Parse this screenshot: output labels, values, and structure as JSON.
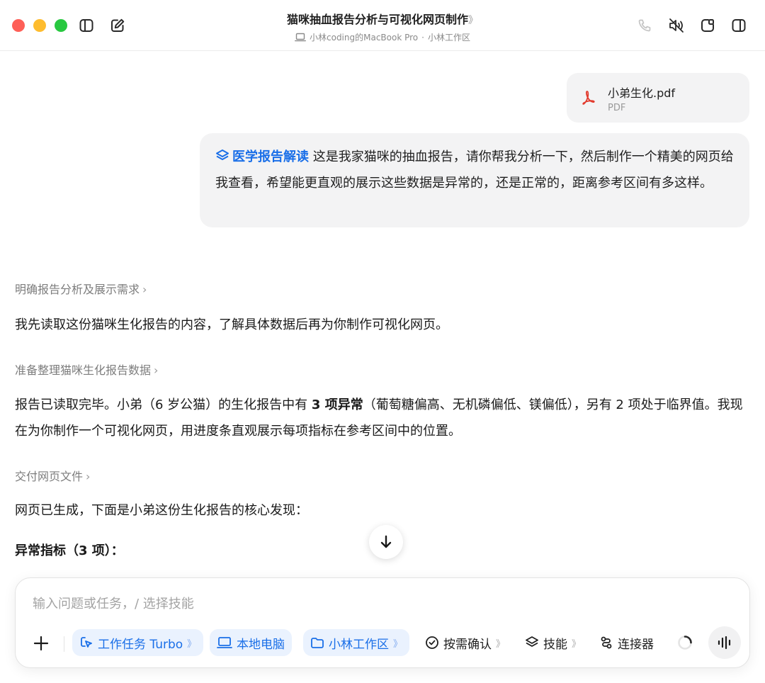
{
  "window": {
    "title": "猫咪抽血报告分析与可视化网页制作",
    "title_chevron": "》",
    "subtitle_device": "小林coding的MacBook Pro",
    "subtitle_sep": "·",
    "subtitle_workspace": "小林工作区"
  },
  "attachment": {
    "file_name": "小弟生化.pdf",
    "file_type": "PDF"
  },
  "user_message": {
    "skill_label": "医学报告解读",
    "text": "这是我家猫咪的抽血报告，请你帮我分析一下，然后制作一个精美的网页给我查看，希望能更直观的展示这些数据是异常的，还是正常的，距离参考区间有多这样。"
  },
  "assistant": {
    "step1": "明确报告分析及展示需求",
    "para1": "我先读取这份猫咪生化报告的内容，了解具体数据后再为你制作可视化网页。",
    "step2": "准备整理猫咪生化报告数据",
    "para2_a": "报告已读取完毕。小弟（6 岁公猫）的生化报告中有 ",
    "para2_bold": "3 项异常",
    "para2_b": "（葡萄糖偏高、无机磷偏低、镁偏低），另有 2 项处于临界值。我现在为你制作一个可视化网页，用进度条直观展示每项指标在参考区间中的位置。",
    "step3": "交付网页文件",
    "para3": "网页已生成，下面是小弟这份生化报告的核心发现：",
    "heading": "异常指标（3 项）："
  },
  "composer": {
    "placeholder": "输入问题或任务，/ 选择技能",
    "chips": {
      "task_mode": "工作任务 Turbo",
      "local": "本地电脑",
      "workspace": "小林工作区",
      "confirm": "按需确认",
      "skills": "技能",
      "connectors": "连接器"
    },
    "chevron": "》"
  }
}
